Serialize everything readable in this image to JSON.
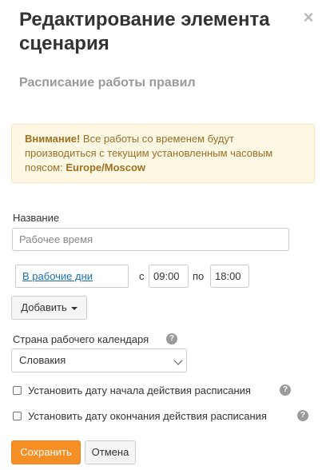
{
  "dialog": {
    "title": "Редактирование элемента сценария",
    "close_glyph": "×",
    "subtitle": "Расписание работы правил"
  },
  "alert": {
    "strong": "Внимание!",
    "text": " Все работы со временем будут производиться с текущим установленным часовым поясом: ",
    "timezone": "Europe/Moscow"
  },
  "form": {
    "name_label": "Название",
    "name_placeholder": "Рабочее время",
    "schedule": {
      "days_link": "В рабочие дни",
      "from_label": "с",
      "from_value": "09:00",
      "to_label": "по",
      "to_value": "18:00"
    },
    "add_button": "Добавить",
    "country_label": "Страна рабочего календаря",
    "country_value": "Словакия",
    "start_date_label": "Установить дату начала действия расписания",
    "end_date_label": "Установить дату окончания действия расписания",
    "help_glyph": "?"
  },
  "footer": {
    "save": "Сохранить",
    "cancel": "Отмена"
  },
  "colors": {
    "accent": "#f58f24",
    "alert_bg": "#fcf8e3",
    "link": "#1a6fb3"
  }
}
